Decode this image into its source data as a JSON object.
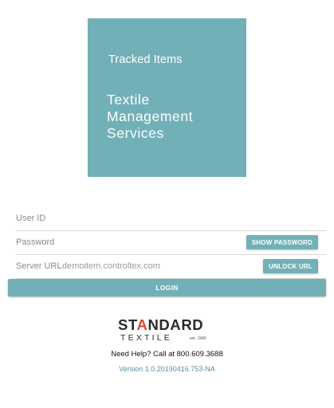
{
  "logo": {
    "tagline": "Tracked Items",
    "name_lines": [
      "Textile",
      "Management",
      "Services"
    ],
    "background_color": "#72b0b8"
  },
  "form": {
    "user_id": {
      "label": "User ID",
      "value": ""
    },
    "password": {
      "label": "Password",
      "value": "",
      "toggle_label": "SHOW PASSWORD"
    },
    "server_url": {
      "label": "Server URL",
      "value": "demoitem.controltex.com",
      "unlock_label": "UNLOCK URL"
    }
  },
  "login_label": "LOGIN",
  "brand": {
    "name_prefix": "ST",
    "name_accent": "A",
    "name_suffix": "NDARD",
    "subname": "TEXTILE",
    "established": "est. 1940",
    "accent_color": "#d9482b"
  },
  "help_text": "Need Help? Call at 800.609.3688",
  "version_text": "Version 1.0.20190416.753-NA",
  "colors": {
    "accent": "#72b0b8",
    "link": "#5a8ea3"
  }
}
